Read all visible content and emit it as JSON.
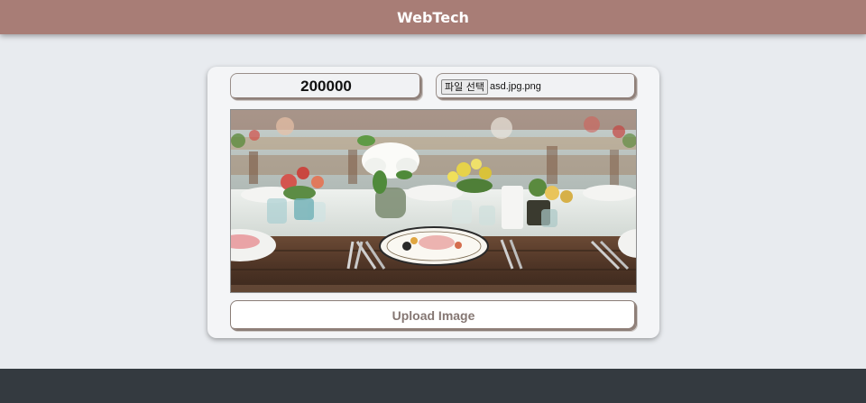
{
  "header": {
    "brand": "WebTech"
  },
  "form": {
    "amount_value": "200000",
    "file_button_label": "파일 선택",
    "file_name": "asd.jpg.png",
    "upload_label": "Upload Image"
  },
  "preview": {
    "icon": "uploaded-photo-table-setting"
  },
  "colors": {
    "header_bg": "#a87d76",
    "page_bg": "#e8ebef",
    "footer_bg": "#343a40",
    "upload_text": "#857773"
  }
}
